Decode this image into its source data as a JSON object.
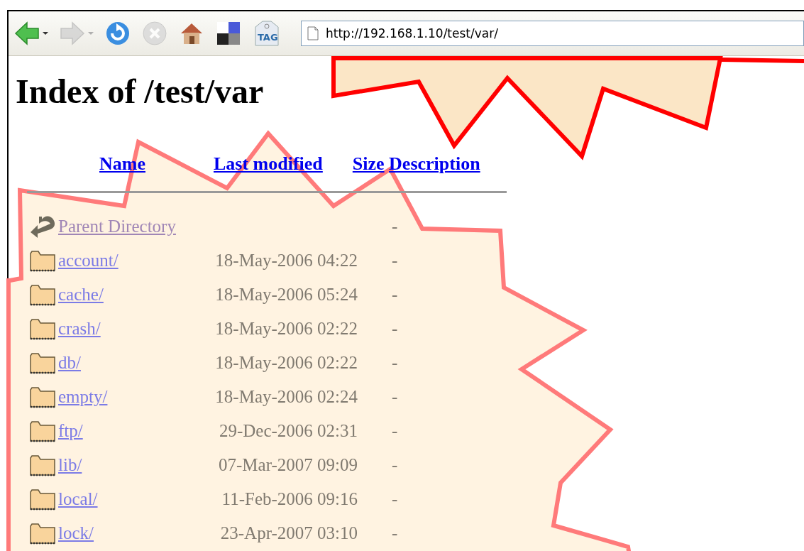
{
  "toolbar": {
    "buttons": [
      {
        "kind": "back",
        "disabled": false
      },
      {
        "kind": "forward",
        "disabled": true
      },
      {
        "kind": "reload",
        "disabled": false
      },
      {
        "kind": "stop",
        "disabled": true
      },
      {
        "kind": "home",
        "disabled": false
      },
      {
        "kind": "tiles",
        "disabled": false
      },
      {
        "kind": "tag",
        "label": "TAG"
      }
    ],
    "address": "http://192.168.1.10/test/var/"
  },
  "page": {
    "heading": "Index of /test/var",
    "columns": [
      "Name",
      "Last modified",
      "Size",
      "Description"
    ],
    "rows": [
      {
        "kind": "parent",
        "name": "Parent Directory",
        "modified": "",
        "size": "-",
        "visited": true
      },
      {
        "kind": "folder",
        "name": "account/",
        "modified": "18-May-2006 04:22",
        "size": "-",
        "visited": false
      },
      {
        "kind": "folder",
        "name": "cache/",
        "modified": "18-May-2006 05:24",
        "size": "-",
        "visited": false
      },
      {
        "kind": "folder",
        "name": "crash/",
        "modified": "18-May-2006 02:22",
        "size": "-",
        "visited": false
      },
      {
        "kind": "folder",
        "name": "db/",
        "modified": "18-May-2006 02:22",
        "size": "-",
        "visited": false
      },
      {
        "kind": "folder",
        "name": "empty/",
        "modified": "18-May-2006 02:24",
        "size": "-",
        "visited": false
      },
      {
        "kind": "folder",
        "name": "ftp/",
        "modified": "29-Dec-2006 02:31",
        "size": "-",
        "visited": false
      },
      {
        "kind": "folder",
        "name": "lib/",
        "modified": "07-Mar-2007 09:09",
        "size": "-",
        "visited": false
      },
      {
        "kind": "folder",
        "name": "local/",
        "modified": "11-Feb-2006 09:16",
        "size": "-",
        "visited": false
      },
      {
        "kind": "folder",
        "name": "lock/",
        "modified": "23-Apr-2007 03:10",
        "size": "-",
        "visited": false
      }
    ]
  }
}
